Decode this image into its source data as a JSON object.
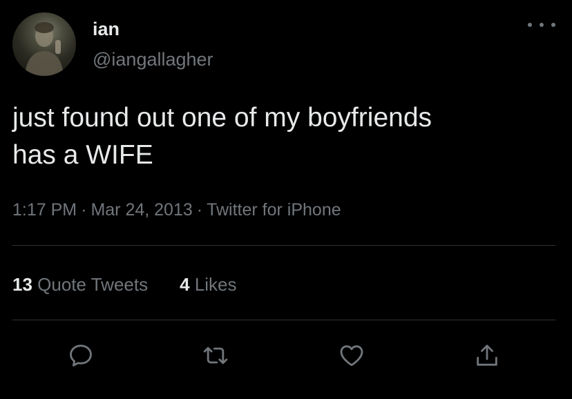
{
  "tweet": {
    "display_name": "ian",
    "handle": "@iangallagher",
    "text_line1": "just found out one of my boyfriends",
    "text_line2": "has a WIFE",
    "time": "1:17 PM",
    "date": "Mar 24, 2013",
    "source": "Twitter for iPhone",
    "separator": "·"
  },
  "stats": {
    "quote_tweets_count": "13",
    "quote_tweets_label": "Quote Tweets",
    "likes_count": "4",
    "likes_label": "Likes"
  },
  "icons": {
    "avatar": "profile-photo",
    "more": "more-options-icon",
    "reply": "reply-icon",
    "retweet": "retweet-icon",
    "like": "heart-icon",
    "share": "share-icon"
  },
  "colors": {
    "background": "#000000",
    "primary_text": "#e7e9ea",
    "secondary_text": "#71767b",
    "divider": "#2f3336"
  }
}
